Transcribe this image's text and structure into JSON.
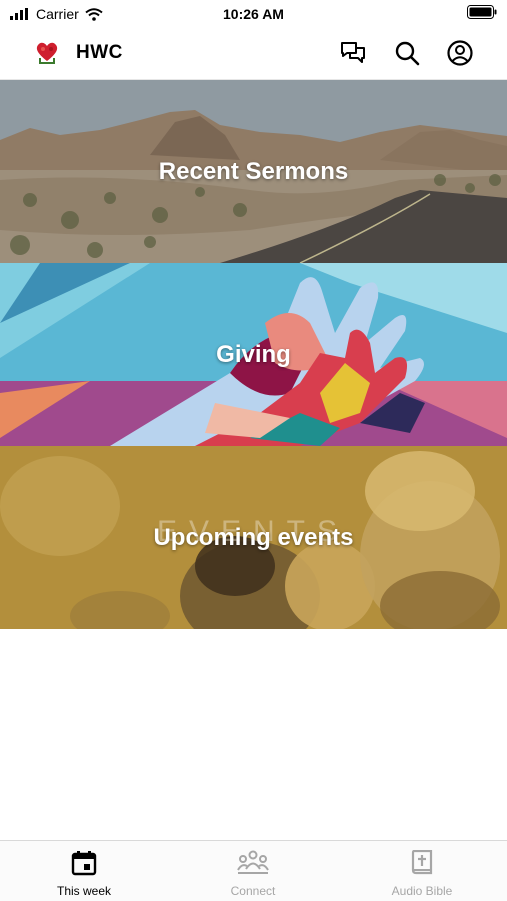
{
  "status_bar": {
    "carrier": "Carrier",
    "time": "10:26 AM"
  },
  "header": {
    "title": "HWC",
    "icons": [
      "chat-icon",
      "search-icon",
      "account-icon"
    ]
  },
  "tiles": [
    {
      "label": "Recent Sermons"
    },
    {
      "label": "Giving"
    },
    {
      "label": "Upcoming events",
      "overlay_text": "EVENTS"
    }
  ],
  "tabs": [
    {
      "label": "This week",
      "icon": "calendar-icon",
      "active": true
    },
    {
      "label": "Connect",
      "icon": "people-icon",
      "active": false
    },
    {
      "label": "Audio Bible",
      "icon": "bible-icon",
      "active": false
    }
  ],
  "colors": {
    "active_tab": "#000000",
    "inactive_tab": "#a6a6a6",
    "events_overlay": "#b38f3c"
  }
}
